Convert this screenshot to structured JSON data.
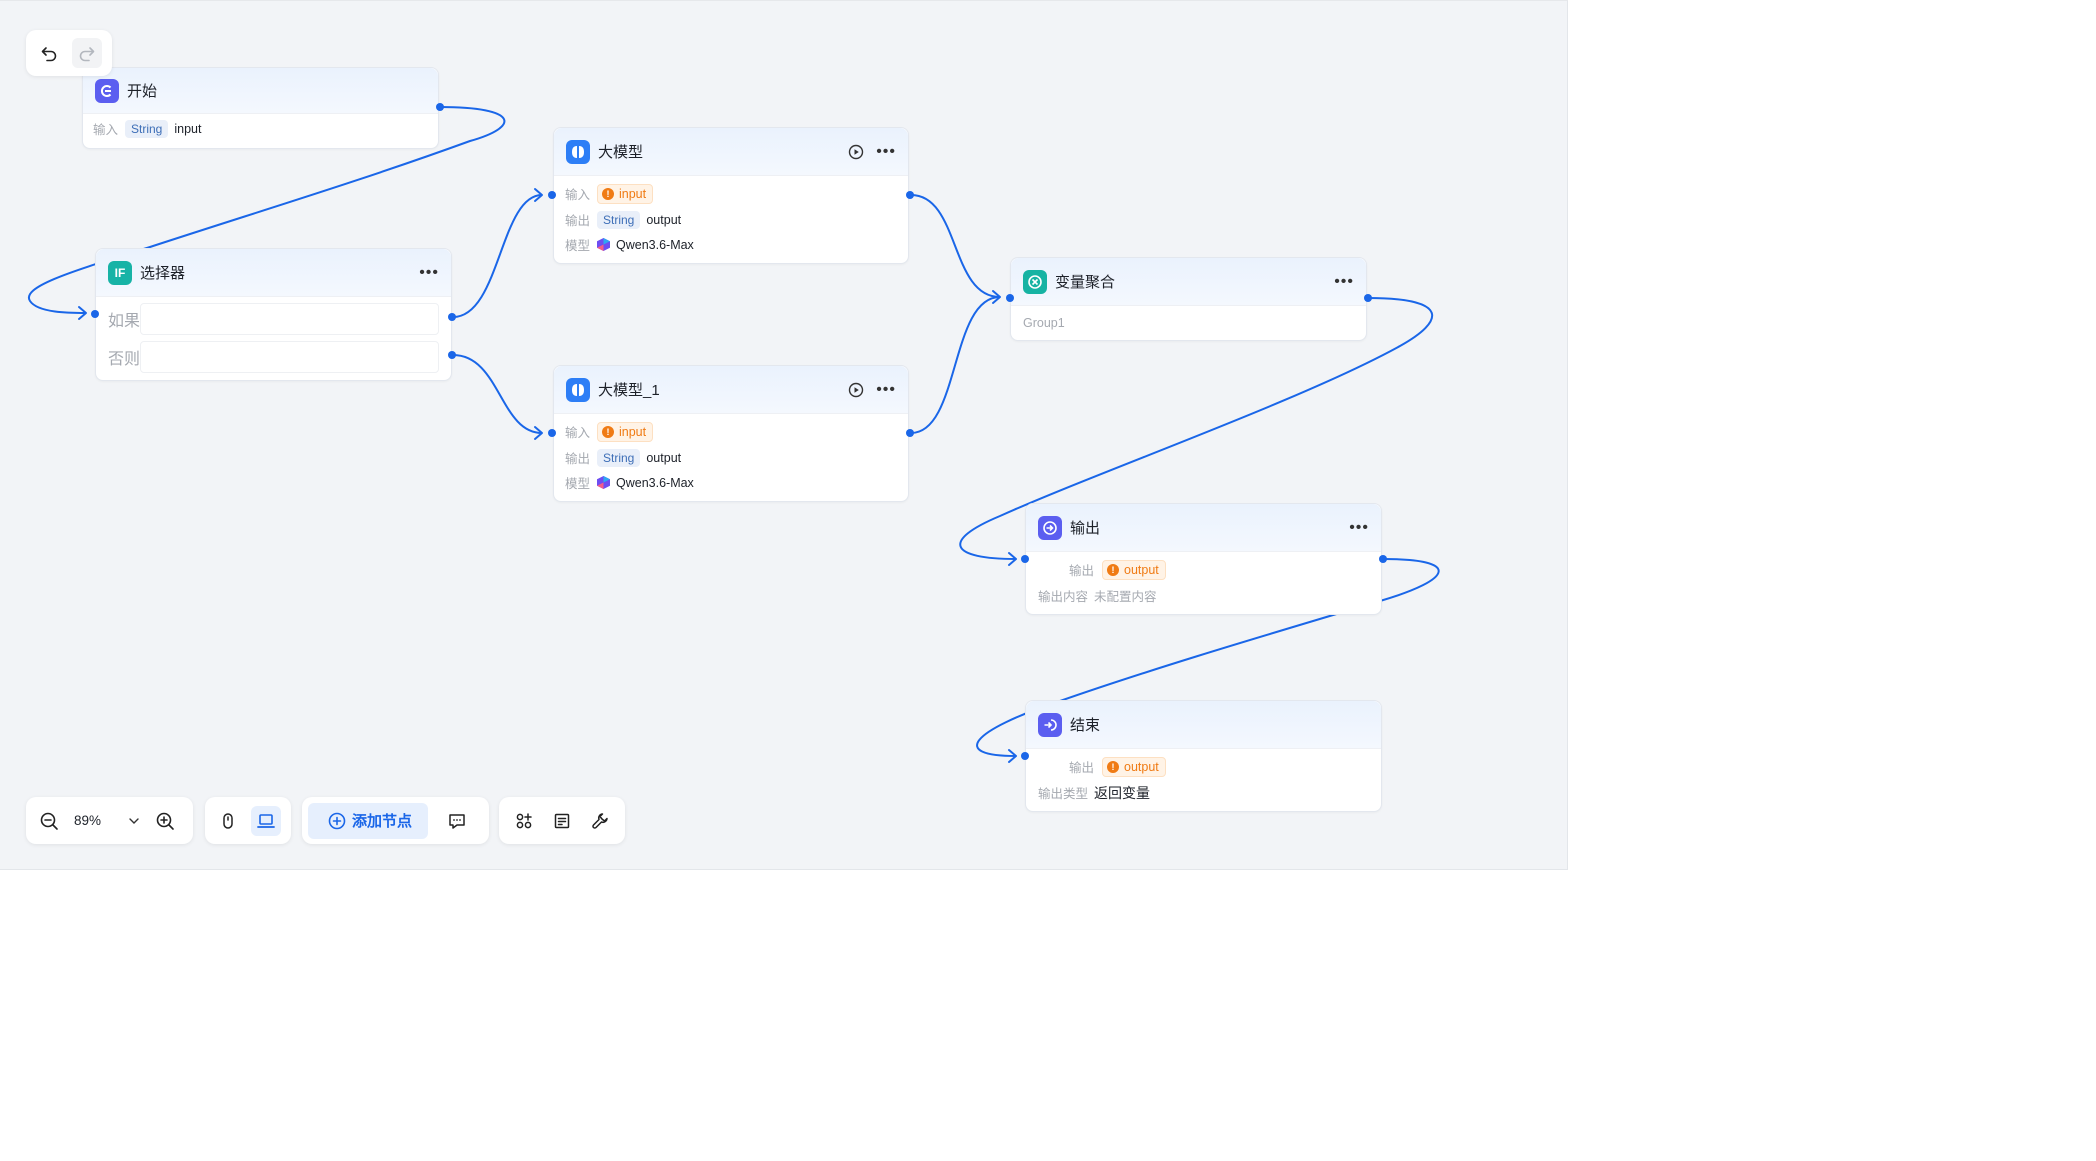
{
  "history": {
    "undo_icon": "undo-icon",
    "redo_icon": "redo-icon"
  },
  "nodes": {
    "start": {
      "title": "开始",
      "input_label": "输入",
      "input_type": "String",
      "input_name": "input"
    },
    "selector": {
      "title": "选择器",
      "icon_text": "IF",
      "if_label": "如果",
      "else_label": "否则"
    },
    "llm": {
      "title": "大模型",
      "input_label": "输入",
      "input_value": "input",
      "output_label": "输出",
      "output_type": "String",
      "output_name": "output",
      "model_label": "模型",
      "model_name": "Qwen3.6-Max"
    },
    "llm1": {
      "title": "大模型_1",
      "input_label": "输入",
      "input_value": "input",
      "output_label": "输出",
      "output_type": "String",
      "output_name": "output",
      "model_label": "模型",
      "model_name": "Qwen3.6-Max"
    },
    "aggregator": {
      "title": "变量聚合",
      "group_name": "Group1"
    },
    "output": {
      "title": "输出",
      "output_label": "输出",
      "output_value": "output",
      "content_label": "输出内容",
      "content_value": "未配置内容"
    },
    "end": {
      "title": "结束",
      "output_label": "输出",
      "output_value": "output",
      "type_label": "输出类型",
      "type_value": "返回变量"
    }
  },
  "bottom_toolbar": {
    "zoom_value": "89%",
    "add_node_label": "添加节点"
  },
  "colors": {
    "edge": "#1a66e8",
    "start_icon": "#5b5ef0",
    "selector_icon": "#17b3a6",
    "llm_icon": "#2d7ef6",
    "aggregator_icon": "#16b3a3",
    "output_icon": "#5b5ef0",
    "warning": "#f07b14"
  }
}
